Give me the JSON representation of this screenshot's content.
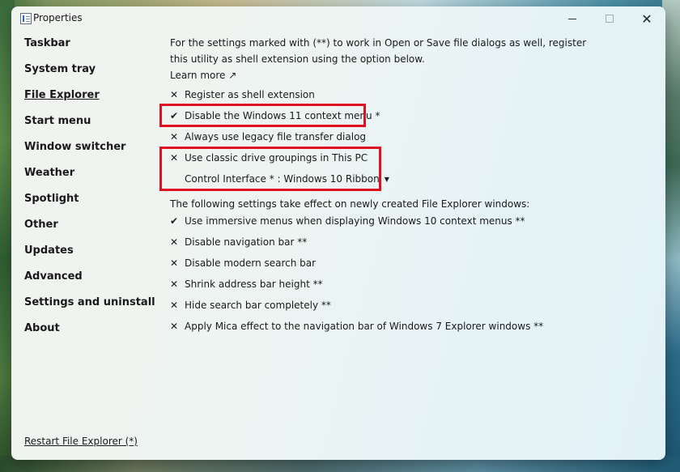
{
  "window": {
    "title": "Properties"
  },
  "title_buttons": {
    "minimize": "",
    "maximize": "",
    "close": "✕"
  },
  "sidebar": {
    "items": [
      {
        "label": "Taskbar"
      },
      {
        "label": "System tray"
      },
      {
        "label": "File Explorer"
      },
      {
        "label": "Start menu"
      },
      {
        "label": "Window switcher"
      },
      {
        "label": "Weather"
      },
      {
        "label": "Spotlight"
      },
      {
        "label": "Other"
      },
      {
        "label": "Updates"
      },
      {
        "label": "Advanced"
      },
      {
        "label": "Settings and uninstall"
      },
      {
        "label": "About"
      }
    ],
    "active": "File Explorer",
    "restart_link": "Restart File Explorer (*)"
  },
  "content": {
    "intro_line1": "For the settings marked with (**) to work in Open or Save file dialogs as well, register",
    "intro_line2": "this utility as shell extension using the option below.",
    "learn_more": "Learn more ↗",
    "options": [
      {
        "mark": "✕",
        "label": "Register as shell extension",
        "checked": false
      },
      {
        "mark": "✔",
        "label": "Disable the Windows 11 context menu *",
        "checked": true
      },
      {
        "mark": "✕",
        "label": "Always use legacy file transfer dialog",
        "checked": false
      },
      {
        "mark": "✕",
        "label": "Use classic drive groupings in This PC",
        "checked": false
      }
    ],
    "control_interface": {
      "label": "Control Interface * : Windows 10 Ribbon",
      "arrow": "▼"
    },
    "new_windows_note": "The following settings take effect on newly created File Explorer windows:",
    "window_options": [
      {
        "mark": "✔",
        "label": "Use immersive menus when displaying Windows 10 context menus **",
        "checked": true
      },
      {
        "mark": "✕",
        "label": "Disable navigation bar **",
        "checked": false
      },
      {
        "mark": "✕",
        "label": "Disable modern search bar",
        "checked": false
      },
      {
        "mark": "✕",
        "label": "Shrink address bar height **",
        "checked": false
      },
      {
        "mark": "✕",
        "label": "Hide search bar completely **",
        "checked": false
      },
      {
        "mark": "✕",
        "label": "Apply Mica effect to the navigation bar of Windows 7 Explorer windows **",
        "checked": false
      }
    ]
  },
  "colors": {
    "highlight": "#e01020",
    "text": "#1a1a1a"
  }
}
